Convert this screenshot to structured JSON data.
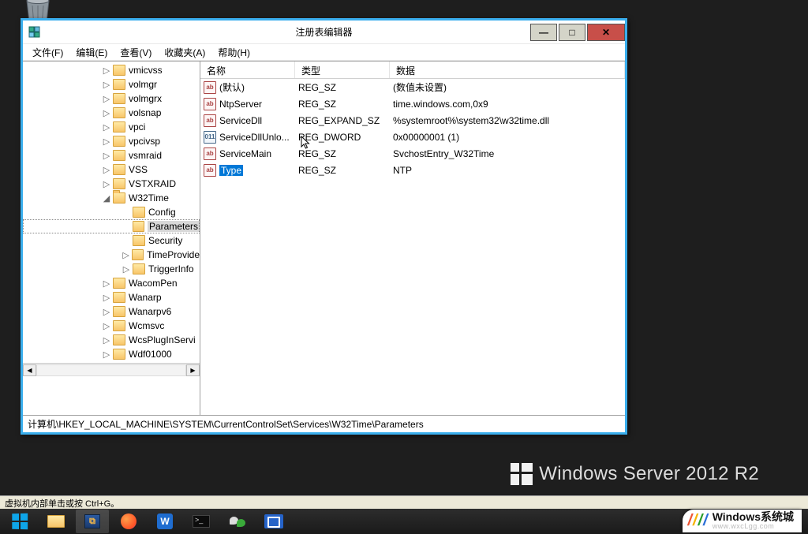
{
  "window": {
    "title": "注册表编辑器",
    "menu": {
      "file": "文件(F)",
      "edit": "编辑(E)",
      "view": "查看(V)",
      "favorites": "收藏夹(A)",
      "help": "帮助(H)"
    },
    "status_path": "计算机\\HKEY_LOCAL_MACHINE\\SYSTEM\\CurrentControlSet\\Services\\W32Time\\Parameters"
  },
  "columns": {
    "name": "名称",
    "type": "类型",
    "data": "数据"
  },
  "tree": {
    "items": [
      {
        "label": "vmicvss",
        "exp": "▷",
        "indent": 100
      },
      {
        "label": "volmgr",
        "exp": "▷",
        "indent": 100
      },
      {
        "label": "volmgrx",
        "exp": "▷",
        "indent": 100
      },
      {
        "label": "volsnap",
        "exp": "▷",
        "indent": 100
      },
      {
        "label": "vpci",
        "exp": "▷",
        "indent": 100
      },
      {
        "label": "vpcivsp",
        "exp": "▷",
        "indent": 100
      },
      {
        "label": "vsmraid",
        "exp": "▷",
        "indent": 100
      },
      {
        "label": "VSS",
        "exp": "▷",
        "indent": 100
      },
      {
        "label": "VSTXRAID",
        "exp": "▷",
        "indent": 100
      },
      {
        "label": "W32Time",
        "exp": "◢",
        "indent": 100,
        "open": true
      },
      {
        "label": "Config",
        "exp": "",
        "indent": 125
      },
      {
        "label": "Parameters",
        "exp": "",
        "indent": 125,
        "selected": true
      },
      {
        "label": "Security",
        "exp": "",
        "indent": 125
      },
      {
        "label": "TimeProvide",
        "exp": "▷",
        "indent": 125
      },
      {
        "label": "TriggerInfo",
        "exp": "▷",
        "indent": 125
      },
      {
        "label": "WacomPen",
        "exp": "▷",
        "indent": 100
      },
      {
        "label": "Wanarp",
        "exp": "▷",
        "indent": 100
      },
      {
        "label": "Wanarpv6",
        "exp": "▷",
        "indent": 100
      },
      {
        "label": "Wcmsvc",
        "exp": "▷",
        "indent": 100
      },
      {
        "label": "WcsPlugInServi",
        "exp": "▷",
        "indent": 100
      },
      {
        "label": "Wdf01000",
        "exp": "▷",
        "indent": 100
      }
    ]
  },
  "values": [
    {
      "name": "(默认)",
      "type": "REG_SZ",
      "data": "(数值未设置)",
      "kind": "sz"
    },
    {
      "name": "NtpServer",
      "type": "REG_SZ",
      "data": "time.windows.com,0x9",
      "kind": "sz"
    },
    {
      "name": "ServiceDll",
      "type": "REG_EXPAND_SZ",
      "data": "%systemroot%\\system32\\w32time.dll",
      "kind": "sz"
    },
    {
      "name": "ServiceDllUnlo...",
      "type": "REG_DWORD",
      "data": "0x00000001 (1)",
      "kind": "bin"
    },
    {
      "name": "ServiceMain",
      "type": "REG_SZ",
      "data": "SvchostEntry_W32Time",
      "kind": "sz"
    },
    {
      "name": "Type",
      "type": "REG_SZ",
      "data": "NTP",
      "kind": "sz",
      "selected": true
    }
  ],
  "branding": {
    "text": "Windows Server 2012",
    "r2": "R2"
  },
  "vm_hint": "虚拟机内部单击或按 Ctrl+G。",
  "watermark": {
    "main": "Windows系统城",
    "sub": "www.wxcLgg.com"
  }
}
